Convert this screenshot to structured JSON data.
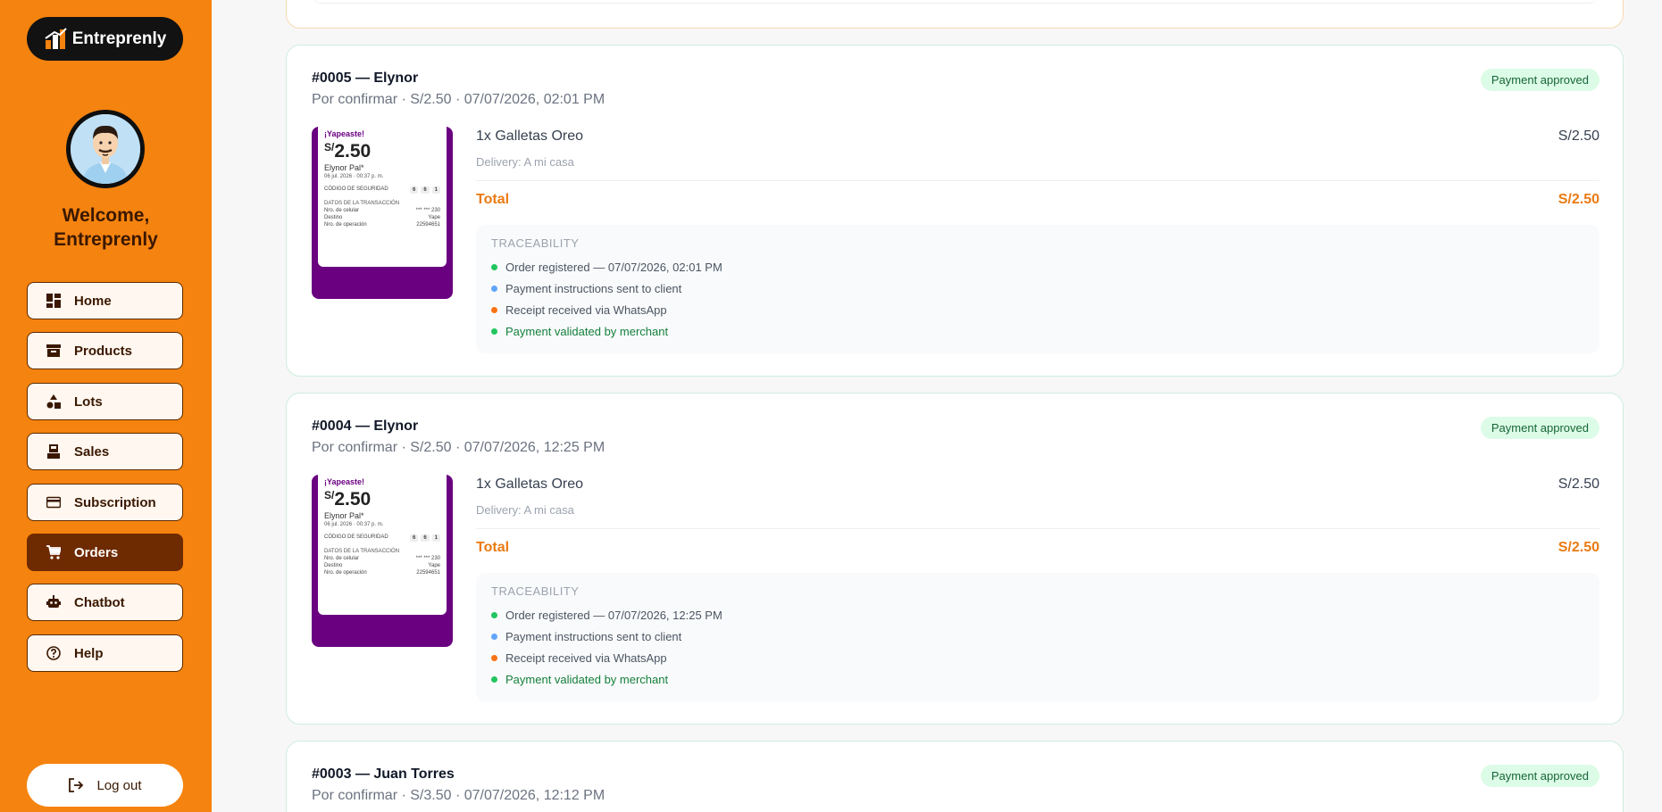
{
  "sidebar": {
    "brand": "Entreprenly",
    "welcome_line1": "Welcome,",
    "welcome_line2": "Entreprenly",
    "items": [
      {
        "label": "Home",
        "icon": "dashboard-icon"
      },
      {
        "label": "Products",
        "icon": "archive-icon"
      },
      {
        "label": "Lots",
        "icon": "shapes-icon"
      },
      {
        "label": "Sales",
        "icon": "register-icon"
      },
      {
        "label": "Subscription",
        "icon": "credit-card-icon"
      },
      {
        "label": "Orders",
        "icon": "cart-icon",
        "active": true
      },
      {
        "label": "Chatbot",
        "icon": "robot-icon"
      },
      {
        "label": "Help",
        "icon": "help-circle-icon"
      }
    ],
    "logout": "Log out"
  },
  "orders": [
    {
      "title": "#0005 — Elynor",
      "subtitle": "Por confirmar · S/2.50 · 07/07/2026, 02:01 PM",
      "badge": "Payment approved",
      "item": "1x Galletas Oreo",
      "item_price": "S/2.50",
      "delivery": "Delivery: A mi casa",
      "total_label": "Total",
      "total": "S/2.50",
      "receipt": {
        "brand": "¡Yapeaste!",
        "currency": "S/",
        "amount": "2.50",
        "name": "Elynor Pal*",
        "date": "06 jul. 2026 · 00:37 p. m.",
        "code_label": "CÓDIGO DE SEGURIDAD",
        "codes": [
          "6",
          "6",
          "1"
        ],
        "section": "DATOS DE LA TRANSACCIÓN",
        "rows": [
          [
            "Nro. de celular",
            "*** *** 230"
          ],
          [
            "Destino",
            "Yape"
          ],
          [
            "Nro. de operación",
            "22594651"
          ]
        ]
      },
      "trace_title": "TRACEABILITY",
      "steps": [
        "Order registered — 07/07/2026, 02:01 PM",
        "Payment instructions sent to client",
        "Receipt received via WhatsApp",
        "Payment validated by merchant"
      ]
    },
    {
      "title": "#0004 — Elynor",
      "subtitle": "Por confirmar · S/2.50 · 07/07/2026, 12:25 PM",
      "badge": "Payment approved",
      "item": "1x Galletas Oreo",
      "item_price": "S/2.50",
      "delivery": "Delivery: A mi casa",
      "total_label": "Total",
      "total": "S/2.50",
      "receipt": {
        "brand": "¡Yapeaste!",
        "currency": "S/",
        "amount": "2.50",
        "name": "Elynor Pal*",
        "date": "06 jul. 2026 · 00:37 p. m.",
        "code_label": "CÓDIGO DE SEGURIDAD",
        "codes": [
          "6",
          "6",
          "1"
        ],
        "section": "DATOS DE LA TRANSACCIÓN",
        "rows": [
          [
            "Nro. de celular",
            "*** *** 230"
          ],
          [
            "Destino",
            "Yape"
          ],
          [
            "Nro. de operación",
            "22594651"
          ]
        ]
      },
      "trace_title": "TRACEABILITY",
      "steps": [
        "Order registered — 07/07/2026, 12:25 PM",
        "Payment instructions sent to client",
        "Receipt received via WhatsApp",
        "Payment validated by merchant"
      ]
    },
    {
      "title": "#0003 — Juan Torres",
      "subtitle": "Por confirmar · S/3.50 · 07/07/2026, 12:12 PM",
      "badge": "Payment approved"
    }
  ],
  "colors": {
    "sidebar": "#f5830f",
    "accent": "#ea7a12",
    "active_nav": "#6e2a00",
    "badge_bg": "#dcfce7",
    "step_green": "#22c55e",
    "step_blue": "#60a5fa",
    "step_orange": "#f97316"
  }
}
